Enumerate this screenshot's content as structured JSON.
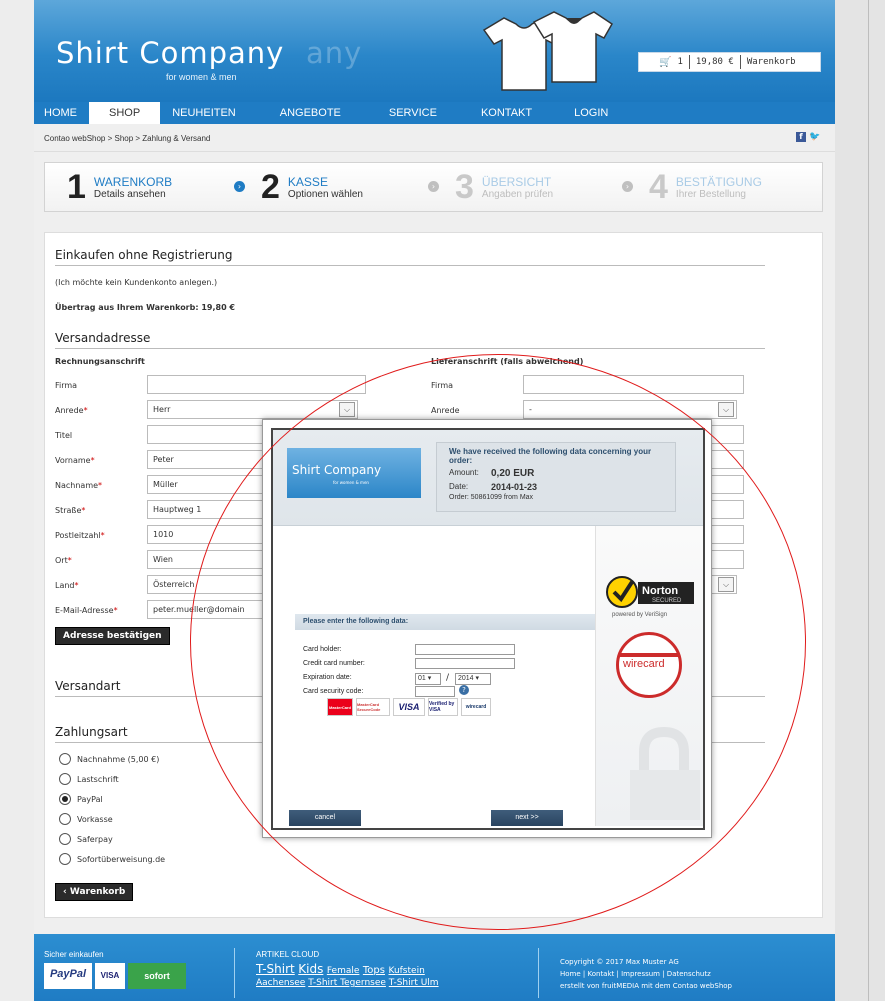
{
  "header": {
    "logo": "Shirt Company",
    "logo_sub": "for women & men",
    "cart_count": "1",
    "cart_total": "19,80 €",
    "cart_label": "Warenkorb"
  },
  "nav": {
    "items": [
      {
        "label": "HOME"
      },
      {
        "label": "SHOP"
      },
      {
        "label": "NEUHEITEN"
      },
      {
        "label": "ANGEBOTE"
      },
      {
        "label": "SERVICE"
      },
      {
        "label": "KONTAKT"
      },
      {
        "label": "LOGIN"
      }
    ],
    "active": "SHOP"
  },
  "breadcrumb": "Contao webShop > Shop > Zahlung & Versand",
  "steps": [
    {
      "num": "1",
      "title": "WARENKORB",
      "sub": "Details ansehen"
    },
    {
      "num": "2",
      "title": "KASSE",
      "sub": "Optionen wählen"
    },
    {
      "num": "3",
      "title": "ÜBERSICHT",
      "sub": "Angaben prüfen"
    },
    {
      "num": "4",
      "title": "BESTÄTIGUNG",
      "sub": "Ihrer Bestellung"
    }
  ],
  "checkout": {
    "guest_heading": "Einkaufen ohne Registrierung",
    "guest_note": "(Ich möchte kein Kundenkonto anlegen.)",
    "carry_over": "Übertrag aus Ihrem Warenkorb: 19,80 €",
    "address_heading": "Versandadresse",
    "billing_heading": "Rechnungsanschrift",
    "shipping_heading": "Lieferanschrift (falls abweichend)",
    "billing_labels": {
      "company": "Firma",
      "salutation": "Anrede",
      "title": "Titel",
      "firstname": "Vorname",
      "lastname": "Nachname",
      "street": "Straße",
      "postal": "Postleitzahl",
      "city": "Ort",
      "country": "Land",
      "email": "E-Mail-Adresse"
    },
    "billing_values": {
      "company": "",
      "salutation": "Herr",
      "title": "",
      "firstname": "Peter",
      "lastname": "Müller",
      "street": "Hauptweg 1",
      "postal": "1010",
      "city": "Wien",
      "country": "Österreich",
      "email": "peter.mueller@domain"
    },
    "shipping_labels": {
      "company": "Firma",
      "salutation": "Anrede"
    },
    "shipping_values": {
      "salutation": "-"
    },
    "confirm_button": "Adresse bestätigen",
    "shipping_method_heading": "Versandart",
    "payment_heading": "Zahlungsart",
    "payment_options": [
      {
        "label": "Nachnahme (5,00 €)"
      },
      {
        "label": "Lastschrift"
      },
      {
        "label": "PayPal"
      },
      {
        "label": "Vorkasse"
      },
      {
        "label": "Saferpay"
      },
      {
        "label": "Sofortüberweisung.de"
      }
    ],
    "payment_selected": "PayPal",
    "back_button": "‹ Warenkorb"
  },
  "footer": {
    "col1_title": "Sicher einkaufen",
    "col1_logos": [
      "PayPal",
      "VISA",
      "sofort"
    ],
    "col2_title": "ARTIKEL CLOUD",
    "tags_row1": [
      "T-Shirt",
      "Kids",
      "Female",
      "Tops",
      "Kufstein"
    ],
    "tags_row2": [
      "Aachensee",
      "T-Shirt Tegernsee",
      "T-Shirt Ulm"
    ],
    "copyright": "Copyright © 2017 Max Muster AG",
    "links": "Home | Kontakt | Impressum | Datenschutz",
    "credit": "erstellt von fruitMEDIA mit dem Contao webShop"
  },
  "popup": {
    "logo": "Shirt Company",
    "logo_sub": "for women & men",
    "info_heading": "We have received the following data concerning your order:",
    "amount_label": "Amount:",
    "amount_value": "0,20  EUR",
    "date_label": "Date:",
    "date_value": "2014-01-23",
    "order_line": "Order: 50861099 from Max",
    "form_heading": "Please enter the following data:",
    "card_holder_label": "Card holder:",
    "card_number_label": "Credit card number:",
    "expiration_label": "Expiration date:",
    "exp_month": "01",
    "exp_year": "2014",
    "exp_sep": "/",
    "cvc_label": "Card security code:",
    "cards": [
      "MasterCard",
      "MasterCard SecureCode",
      "VISA",
      "Verified by VISA",
      "wirecard"
    ],
    "norton_text": "Norton",
    "norton_secured": "SECURED",
    "norton_powered": "powered by VeriSign",
    "wirecard_text": "wirecard",
    "cancel_button": "cancel",
    "next_button": "next >>"
  },
  "colors": {
    "brand_blue": "#1f7cc4",
    "annotation_red": "#e01b1b"
  }
}
